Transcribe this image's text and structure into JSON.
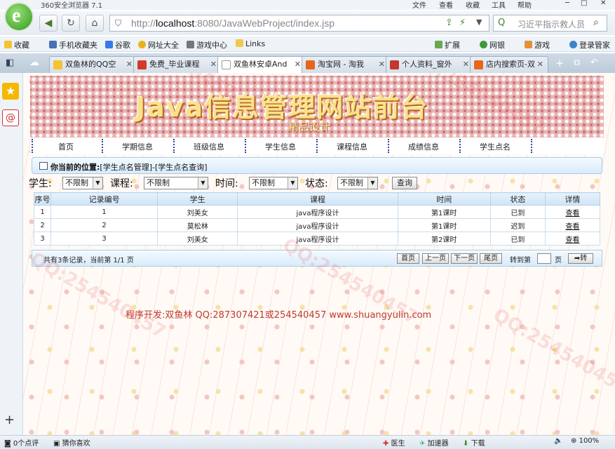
{
  "browser": {
    "title": "360安全浏览器 7.1",
    "menus": [
      "文件",
      "查看",
      "收藏",
      "工具",
      "帮助"
    ],
    "url_host": "localhost",
    "url_rest": ":8080/JavaWebProject/index.jsp",
    "url_prefix": "http://",
    "search_placeholder": "习近平指示救人员",
    "favorites": [
      "收藏",
      "手机收藏夹",
      "谷歌",
      "网址大全",
      "游戏中心",
      "Links",
      "扩展",
      "网银",
      "游戏",
      "登录管家"
    ],
    "tabs": [
      {
        "label": "双鱼林的QQ空",
        "active": false
      },
      {
        "label": "免费_毕业课程",
        "active": false
      },
      {
        "label": "双鱼林安卓And",
        "active": true
      },
      {
        "label": "淘宝网 - 淘我",
        "active": false
      },
      {
        "label": "个人资料_窗外",
        "active": false
      },
      {
        "label": "店内搜索页-双",
        "active": false
      }
    ],
    "status": {
      "comments": "0个点评",
      "guess": "猜你喜欢",
      "doctor": "医生",
      "accel": "加速器",
      "download": "下载",
      "zoom": "100%"
    }
  },
  "site": {
    "title": "Java信息管理网站前台",
    "subtitle": "精品设计",
    "menu": [
      "首页",
      "学期信息",
      "班级信息",
      "学生信息",
      "课程信息",
      "成绩信息",
      "学生点名"
    ],
    "position_label": "你当前的位置:",
    "position_path": "[学生点名管理]-[学生点名查询]",
    "footer": "程序开发:双鱼林 QQ:287307421或254540457 www.shuangyulin.com"
  },
  "filter": {
    "student_label": "学生:",
    "student_value": "不限制",
    "course_label": "课程:",
    "course_value": "不限制",
    "time_label": "时间:",
    "time_value": "不限制",
    "state_label": "状态:",
    "state_value": "不限制",
    "query_label": "查询"
  },
  "table": {
    "headers": [
      "序号",
      "记录编号",
      "学生",
      "课程",
      "时间",
      "状态",
      "详情"
    ],
    "rows": [
      {
        "no": "1",
        "id": "1",
        "student": "刘美女",
        "course": "java程序设计",
        "time": "第1课时",
        "state": "已到",
        "detail": "查看"
      },
      {
        "no": "2",
        "id": "2",
        "student": "莫松林",
        "course": "java程序设计",
        "time": "第1课时",
        "state": "迟到",
        "detail": "查看"
      },
      {
        "no": "3",
        "id": "3",
        "student": "刘美女",
        "course": "java程序设计",
        "time": "第2课时",
        "state": "已到",
        "detail": "查看"
      }
    ]
  },
  "pager": {
    "info": "共有3条记录，当前第 1/1 页",
    "first": "首页",
    "prev": "上一页",
    "next": "下一页",
    "last": "尾页",
    "goto_label": "转到第",
    "page_unit": "页",
    "go": "➡转"
  },
  "watermark": "QQ:254540457"
}
